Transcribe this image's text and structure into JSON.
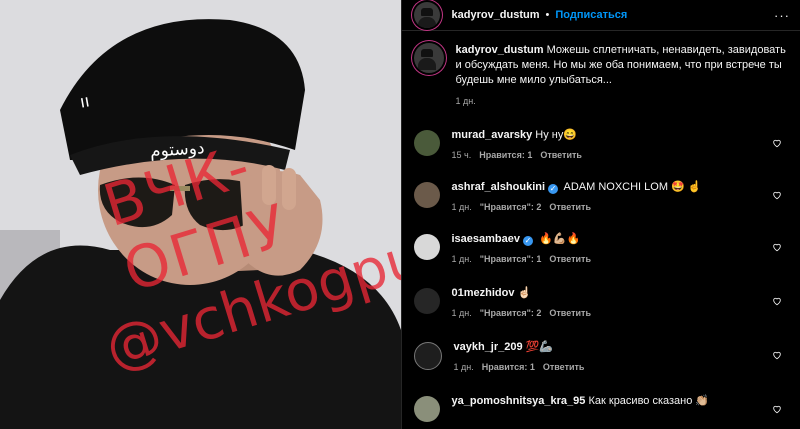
{
  "header": {
    "username": "kadyrov_dustum",
    "separator": "•",
    "follow_label": "Подписаться",
    "more_label": "···"
  },
  "photo": {
    "cap_text": "دوستوم",
    "cap_side_text": "ıı",
    "watermark_line1": "ВЧК-ОГПУ",
    "watermark_line2": "@vchkogpu"
  },
  "caption": {
    "username": "kadyrov_dustum",
    "text": "Можешь сплетничать, ненавидеть, завидовать и обсуждать меня. Но мы же оба понимаем, что при встрече ты будешь мне мило улыбаться...",
    "time": "1 дн."
  },
  "comments": [
    {
      "username": "murad_avarsky",
      "text": "Ну ну😄",
      "time": "15 ч.",
      "likes": "Нравится: 1",
      "reply": "Ответить",
      "verified": false
    },
    {
      "username": "ashraf_alshoukini",
      "text": "ADAM NOXCHI LOM 🤩 ☝️",
      "time": "1 дн.",
      "likes": "\"Нравится\": 2",
      "reply": "Ответить",
      "verified": true
    },
    {
      "username": "isaesambaev",
      "text": "🔥💪🏼🔥",
      "time": "1 дн.",
      "likes": "\"Нравится\": 1",
      "reply": "Ответить",
      "verified": true
    },
    {
      "username": "01mezhidov",
      "text": "☝🏻",
      "time": "1 дн.",
      "likes": "\"Нравится\": 2",
      "reply": "Ответить",
      "verified": false
    },
    {
      "username": "vaykh_jr_209",
      "text": "💯🦾",
      "time": "1 дн.",
      "likes": "Нравится: 1",
      "reply": "Ответить",
      "verified": false
    },
    {
      "username": "ya_pomoshnitsya_kra_95",
      "text": "Как красиво сказано 👏🏼",
      "time": "",
      "likes": "",
      "reply": "",
      "verified": false
    }
  ],
  "colors": {
    "accent": "#0095f6",
    "verified": "#3897f0",
    "watermark": "#e82634"
  }
}
